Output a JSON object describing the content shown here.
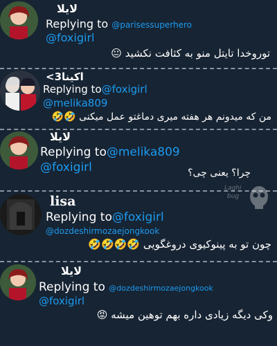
{
  "tweets": [
    {
      "name": "لایلا",
      "reply_prefix": "Replying to",
      "reply_handle": "@parisessuperhero",
      "mention": "@foxigirl",
      "text": "توروخدا تایتل منو به کثافت نکشید",
      "emoji": "😐"
    },
    {
      "name": "اکینا3>",
      "reply_prefix": "Replying to",
      "reply_handle": "@foxigirl",
      "mention": "@melika809",
      "text": "من که میدونم هر هفته میری دماغتو عمل میکنی",
      "emoji": "🤣🤣"
    },
    {
      "name": "لایلا",
      "reply_prefix": "Replying to",
      "reply_handle": "@melika809",
      "mention": "@foxigirl",
      "text": "چرا؟ یعنی چی؟",
      "emoji": ""
    },
    {
      "name": "lisa",
      "reply_prefix": "Replying to",
      "reply_handle": "@foxigirl",
      "mention": "@dozdeshirmozaejongkook",
      "text": "چون تو به پینوکیوی دروغگویی",
      "emoji": "🤣🤣🤣🤣"
    },
    {
      "name": "لایلا",
      "reply_prefix": "Replying to",
      "reply_handle": "@dozdeshirmozaejongkook",
      "mention": "@foxigirl",
      "text": "وکی دیگه زیادی داره بهم توهین میشه",
      "emoji": "😡"
    }
  ],
  "watermark_text": "Laghi bug"
}
